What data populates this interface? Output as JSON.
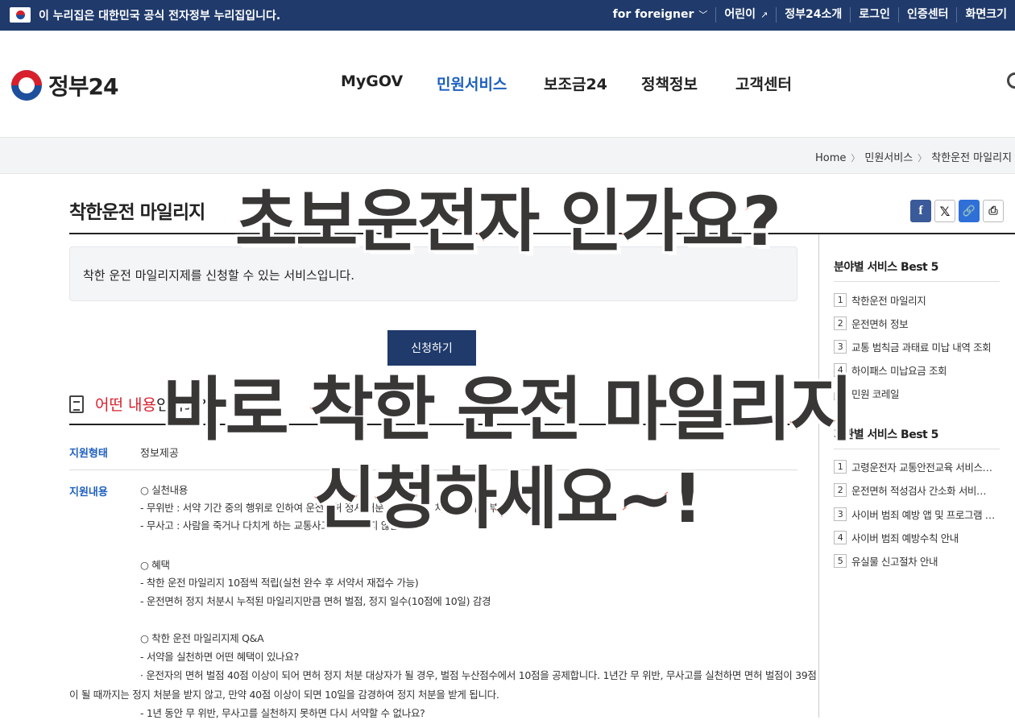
{
  "topbar": {
    "notice": "이 누리집은 대한민국 공식 전자정부 누리집입니다.",
    "links": [
      "for foreigner",
      "어린이",
      "정부24소개",
      "로그인",
      "인증센터",
      "화면크기"
    ]
  },
  "header": {
    "logo_text": "정부24",
    "nav": [
      "MyGOV",
      "민원서비스",
      "보조금24",
      "정책정보",
      "고객센터"
    ],
    "active_nav": "민원서비스"
  },
  "breadcrumb": [
    "Home",
    "민원서비스",
    "착한운전 마일리지"
  ],
  "page": {
    "title": "착한운전 마일리지",
    "description": "착한 운전 마일리지제를 신청할 수 있는 서비스입니다.",
    "apply_button": "신청하기",
    "section_heading_red": "어떤 내용",
    "section_heading_rest": "인가요?",
    "support_type_label": "지원형태",
    "support_type_value": "정보제공",
    "support_content_label": "지원내용",
    "content_lines": [
      "○ 실천내용",
      " - 무위반 : 서약 기간 중의 행위로 인하여 운전면허 정지 처분, 벌점 부과, 처분, 과태료 부과",
      " - 무사고 : 사람을 죽거나 다치게 하는 교통사고를 유발하지 않을 것",
      "",
      "○ 혜택",
      " - 착한 운전 마일리지 10점씩 적립(실천 완수 후 서약서 재접수 가능)",
      " - 운전면허 정지 처분시 누적된 마일리지만큼 면허 벌점, 정지 일수(10점에 10일) 감경",
      "",
      "○ 착한 운전 마일리지제 Q&A",
      " - 서약을 실천하면 어떤 혜택이 있나요?",
      "  · 운전자의 면허 벌점 40점 이상이 되어 면허 정지 처분 대상자가 될 경우, 벌점 누산점수에서 10점을 공제합니다. 1년간 무 위반, 무사고를 실천하면 면허 벌점이 39점",
      "이 될 때까지는 정지 처분을 받지 않고, 만약 40점 이상이 되면 10일을 감경하여 정지 처분을 받게 됩니다.",
      " - 1년 동안 무 위반, 무사고를 실천하지 못하면 다시 서약할 수 없나요?"
    ]
  },
  "aside": {
    "field_best_title": "분야별 서비스 Best 5",
    "field_best": [
      "착한운전 마일리지",
      "운전면허 정보",
      "교통 범칙금 과태료 미납 내역 조회",
      "하이패스 미납요금 조회",
      "민원 코레일"
    ],
    "agency_best_title": "기관별 서비스 Best 5",
    "agency_best": [
      "고령운전자 교통안전교육 서비스…",
      "운전면허 적성검사 간소화 서비…",
      "사이버 범죄 예방 앱 및 프로그램 …",
      "사이버 범죄 예방수칙 안내",
      "유실물 신고절차 안내"
    ]
  },
  "overlay": {
    "line1": "초보운전자 인가요?",
    "line2": "바로 착한 운전 마일리지",
    "line3": "신청하세요~!"
  },
  "colors": {
    "topbar": "#1f3a6b",
    "accent": "#1d5fbf",
    "red": "#d8202d",
    "overlay_stroke": "#e2411f"
  }
}
